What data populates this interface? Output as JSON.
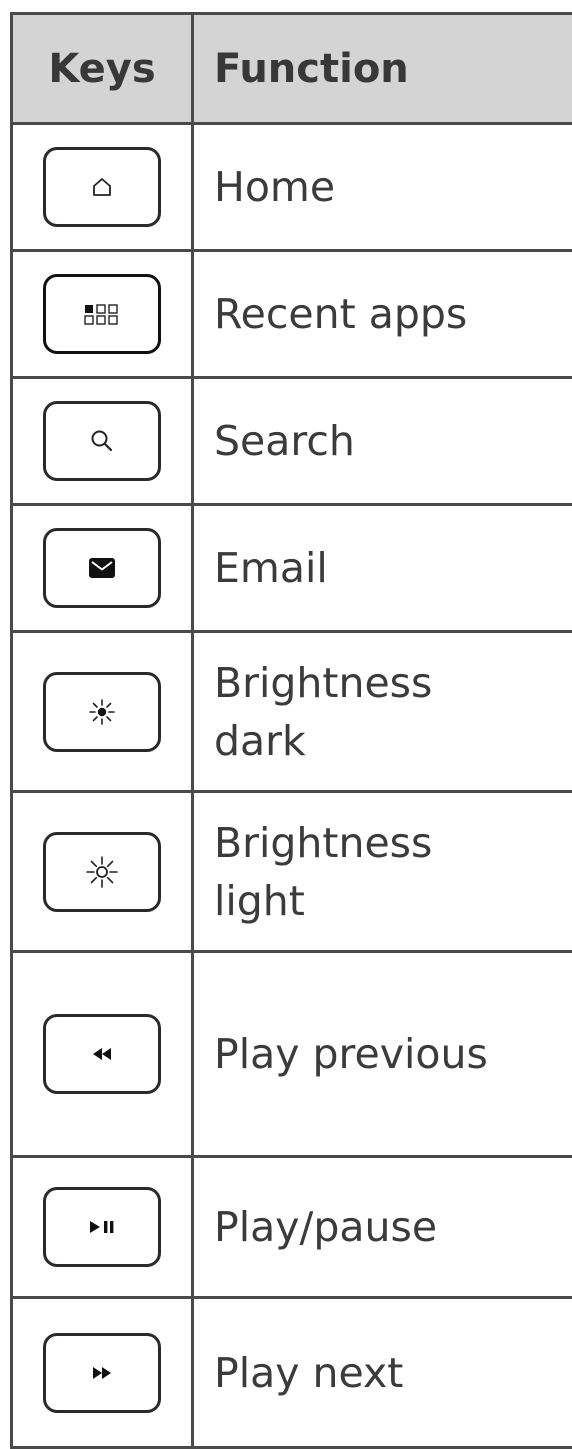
{
  "table": {
    "headers": {
      "keys": "Keys",
      "function": "Function"
    },
    "rows": [
      {
        "icon": "home-icon",
        "function": "Home"
      },
      {
        "icon": "recent-apps-icon",
        "function": "Recent apps"
      },
      {
        "icon": "search-icon",
        "function": "Search"
      },
      {
        "icon": "email-icon",
        "function": "Email"
      },
      {
        "icon": "brightness-dark-icon",
        "function_line1": "Brightness",
        "function_line2": "dark"
      },
      {
        "icon": "brightness-light-icon",
        "function_line1": "Brightness",
        "function_line2": "light"
      },
      {
        "icon": "rewind-icon",
        "function": "Play previous"
      },
      {
        "icon": "play-pause-icon",
        "function": "Play/pause"
      },
      {
        "icon": "fast-forward-icon",
        "function": "Play next"
      }
    ]
  },
  "colors": {
    "header_background": "#d4d4d4",
    "border": "#4a4a4a",
    "text": "#3b3b3b"
  }
}
